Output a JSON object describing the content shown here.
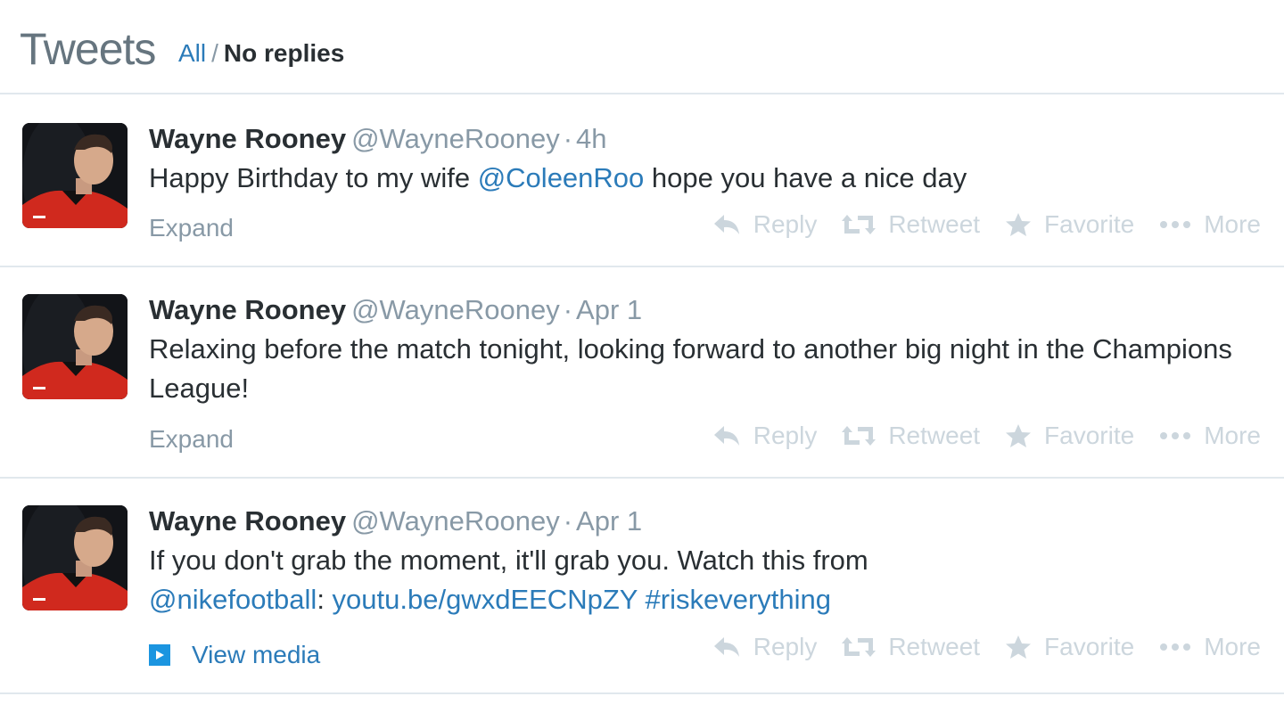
{
  "header": {
    "title": "Tweets",
    "filter_all": "All",
    "filter_sep": "/",
    "filter_noreplies": "No replies"
  },
  "actions": {
    "reply": "Reply",
    "retweet": "Retweet",
    "favorite": "Favorite",
    "more": "More"
  },
  "tweets": [
    {
      "name": "Wayne Rooney",
      "handle": "@WayneRooney",
      "dot": "·",
      "time": "4h",
      "text_1": "Happy Birthday to my wife ",
      "mention": "@ColeenRoo",
      "text_2": " hope you have a nice day",
      "footer": "Expand"
    },
    {
      "name": "Wayne Rooney",
      "handle": "@WayneRooney",
      "dot": "·",
      "time": "Apr 1",
      "text": "Relaxing before the match tonight, looking forward to another big night in the Champions League!",
      "footer": "Expand"
    },
    {
      "name": "Wayne Rooney",
      "handle": "@WayneRooney",
      "dot": "·",
      "time": "Apr 1",
      "text_1": "If you don't grab the moment, it'll grab you. Watch this from ",
      "mention": "@nikefootball",
      "text_2": ": ",
      "url": "youtu.be/gwxdEECNpZY",
      "text_3": " ",
      "hashtag": "#riskeverything",
      "footer": "View media"
    }
  ],
  "colors": {
    "link": "#2b7bb9",
    "muted": "#8899a6",
    "action": "#ccd6dd",
    "divider": "#e1e8ed",
    "kit_red": "#d0291e"
  }
}
